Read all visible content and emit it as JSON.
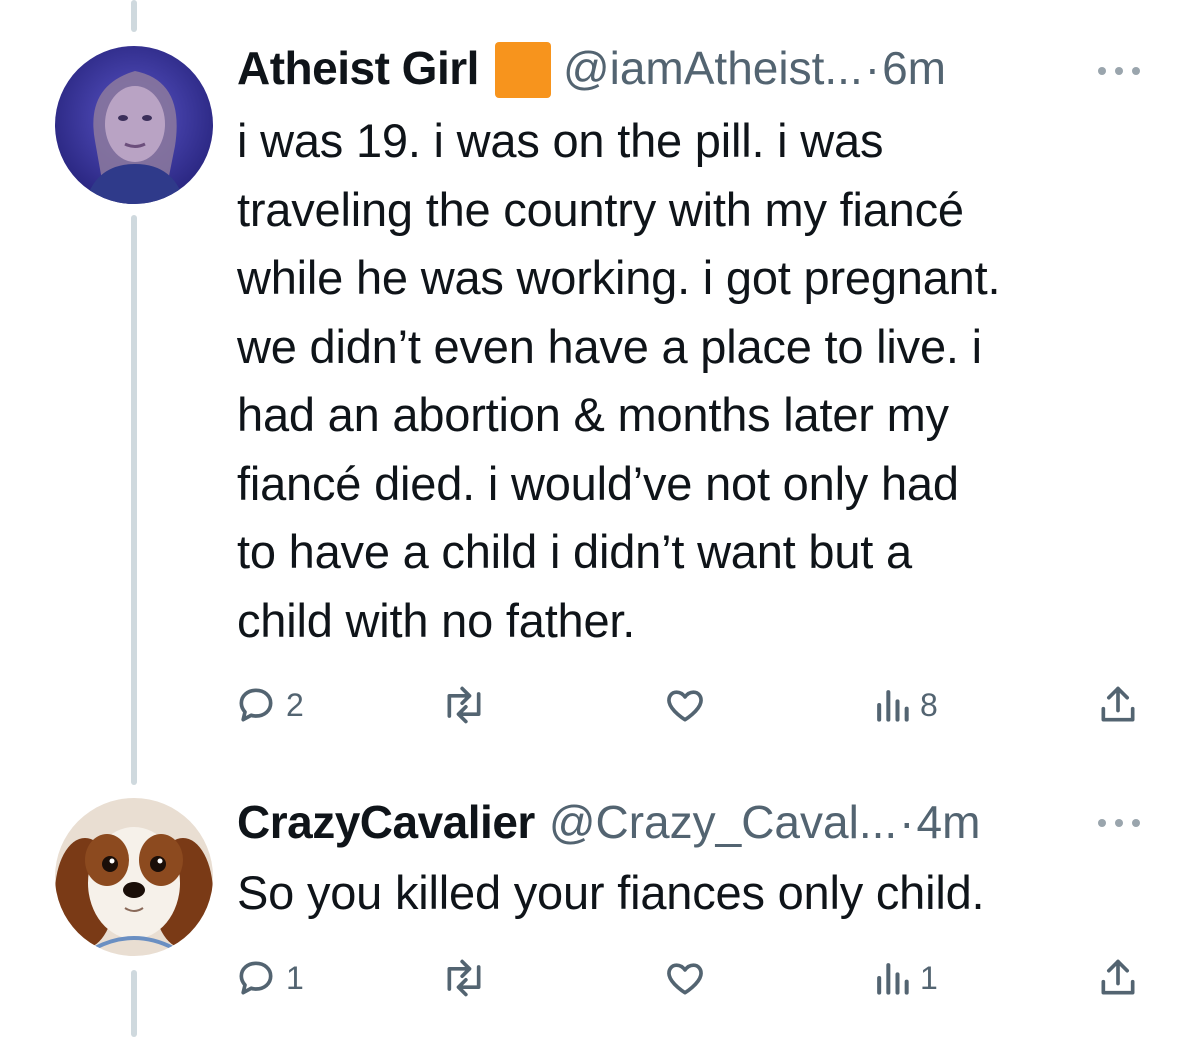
{
  "tweets": [
    {
      "display_name": "Atheist Girl",
      "handle": "@iamAtheist...",
      "dot": "·",
      "time": "6m",
      "badge_color": "#f7941d",
      "avatar_icon": "woman-portrait-avatar",
      "text_lines": [
        "i was 19. i was on the pill. i was",
        "traveling the country with my fiancé",
        "while he was working. i got pregnant.",
        "we didn’t even have a place to live. i",
        "had an abortion & months later my",
        "fiancé died. i would’ve not only had",
        "to have a child i didn’t want but a",
        "child with no father."
      ],
      "reply_count": "2",
      "retweet_count": "",
      "like_count": "",
      "view_count": "8"
    },
    {
      "display_name": "CrazyCavalier",
      "handle": "@Crazy_Caval...",
      "dot": "·",
      "time": "4m",
      "avatar_icon": "cavalier-dog-avatar",
      "text_lines": [
        "So you killed your fiances only child."
      ],
      "reply_count": "1",
      "retweet_count": "",
      "like_count": "",
      "view_count": "1"
    }
  ],
  "colors": {
    "text": "#0f1419",
    "secondary": "#536471",
    "thread_line": "#cfd9de"
  }
}
